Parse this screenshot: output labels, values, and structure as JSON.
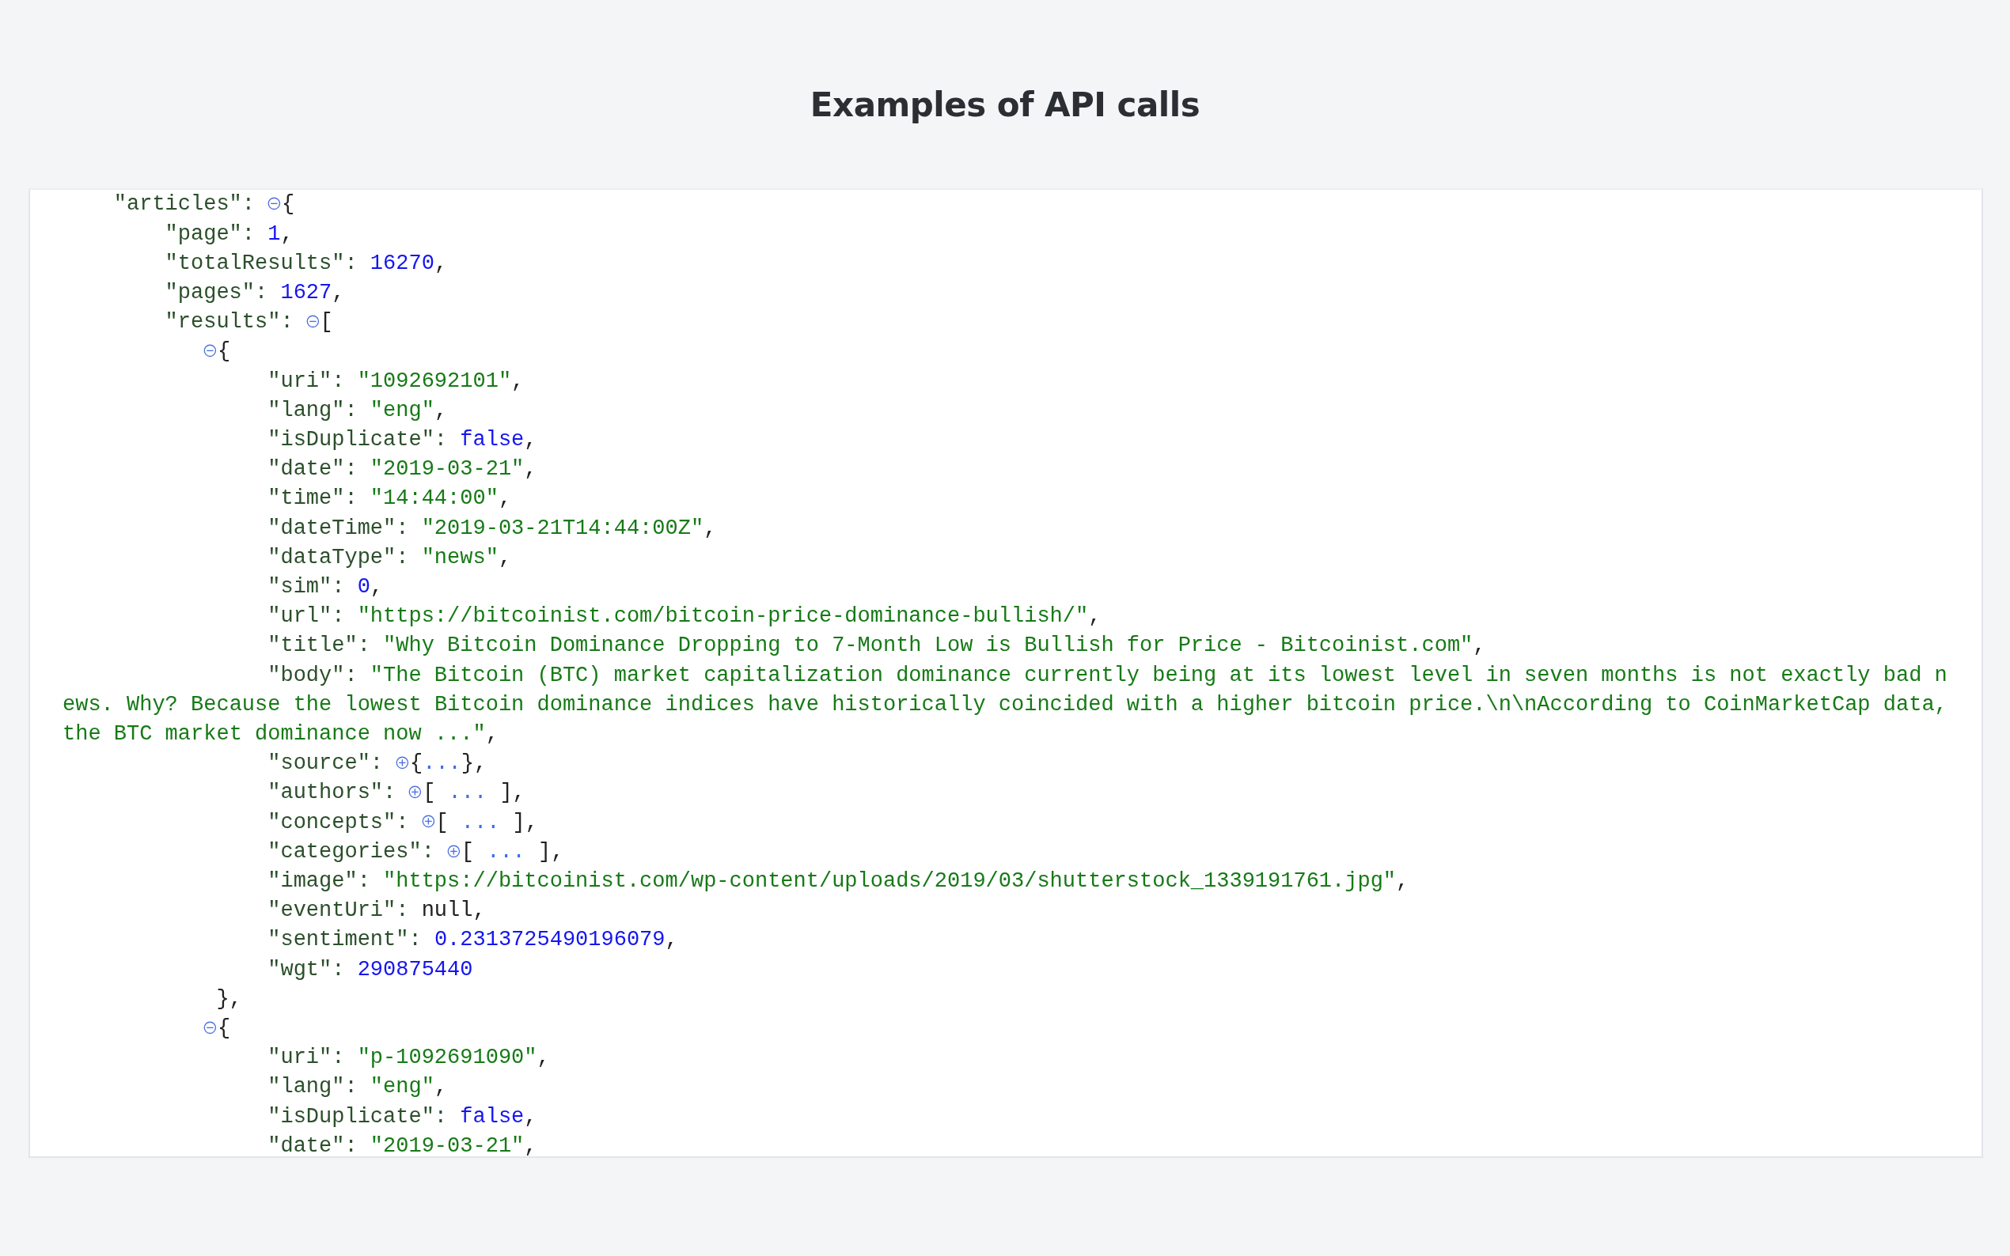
{
  "page_title": "Examples of API calls",
  "tree": {
    "key": "\"articles\": ",
    "expanded": true,
    "open": "{",
    "children": [
      {
        "key": "\"page\": ",
        "kind": "number",
        "value": "1",
        "tail": ","
      },
      {
        "key": "\"totalResults\": ",
        "kind": "number",
        "value": "16270",
        "tail": ","
      },
      {
        "key": "\"pages\": ",
        "kind": "number",
        "value": "1627",
        "tail": ","
      },
      {
        "key": "\"results\": ",
        "expanded": true,
        "open": "[",
        "children": [
          {
            "expanded": true,
            "open": "{",
            "close": "},",
            "children": [
              {
                "key": "\"uri\": ",
                "kind": "string",
                "value": "\"1092692101\"",
                "tail": ","
              },
              {
                "key": "\"lang\": ",
                "kind": "string",
                "value": "\"eng\"",
                "tail": ","
              },
              {
                "key": "\"isDuplicate\": ",
                "kind": "boolean",
                "value": "false",
                "tail": ","
              },
              {
                "key": "\"date\": ",
                "kind": "string",
                "value": "\"2019-03-21\"",
                "tail": ","
              },
              {
                "key": "\"time\": ",
                "kind": "string",
                "value": "\"14:44:00\"",
                "tail": ","
              },
              {
                "key": "\"dateTime\": ",
                "kind": "string",
                "value": "\"2019-03-21T14:44:00Z\"",
                "tail": ","
              },
              {
                "key": "\"dataType\": ",
                "kind": "string",
                "value": "\"news\"",
                "tail": ","
              },
              {
                "key": "\"sim\": ",
                "kind": "number",
                "value": "0",
                "tail": ","
              },
              {
                "key": "\"url\": ",
                "kind": "string",
                "value": "\"https://bitcoinist.com/bitcoin-price-dominance-bullish/\"",
                "tail": ","
              },
              {
                "key": "\"title\": ",
                "kind": "string",
                "value": "\"Why Bitcoin Dominance Dropping to 7-Month Low is Bullish for Price - Bitcoinist.com\"",
                "tail": ","
              },
              {
                "key": "\"body\": ",
                "kind": "string",
                "value": "\"The Bitcoin (BTC) market capitalization dominance currently being at its lowest level in seven months is not exactly bad news. Why? Because the lowest Bitcoin dominance indices have historically coincided with a higher bitcoin price.\\n\\nAccording to CoinMarketCap data, the BTC market dominance now ...\"",
                "tail": ","
              },
              {
                "key": "\"source\": ",
                "expanded": false,
                "open": "{",
                "preview": "...",
                "close": "},"
              },
              {
                "key": "\"authors\": ",
                "expanded": false,
                "open": "[ ",
                "preview": "...",
                "close": " ],"
              },
              {
                "key": "\"concepts\": ",
                "expanded": false,
                "open": "[ ",
                "preview": "...",
                "close": " ],"
              },
              {
                "key": "\"categories\": ",
                "expanded": false,
                "open": "[ ",
                "preview": "...",
                "close": " ],"
              },
              {
                "key": "\"image\": ",
                "kind": "string",
                "value": "\"https://bitcoinist.com/wp-content/uploads/2019/03/shutterstock_1339191761.jpg\"",
                "tail": ","
              },
              {
                "key": "\"eventUri\": ",
                "kind": "null",
                "value": "null",
                "tail": ","
              },
              {
                "key": "\"sentiment\": ",
                "kind": "number",
                "value": "0.2313725490196079",
                "tail": ","
              },
              {
                "key": "\"wgt\": ",
                "kind": "number",
                "value": "290875440"
              }
            ]
          },
          {
            "expanded": true,
            "open": "{",
            "children": [
              {
                "key": "\"uri\": ",
                "kind": "string",
                "value": "\"p-1092691090\"",
                "tail": ","
              },
              {
                "key": "\"lang\": ",
                "kind": "string",
                "value": "\"eng\"",
                "tail": ","
              },
              {
                "key": "\"isDuplicate\": ",
                "kind": "boolean",
                "value": "false",
                "tail": ","
              },
              {
                "key": "\"date\": ",
                "kind": "string",
                "value": "\"2019-03-21\"",
                "tail": ","
              }
            ]
          }
        ]
      }
    ]
  }
}
